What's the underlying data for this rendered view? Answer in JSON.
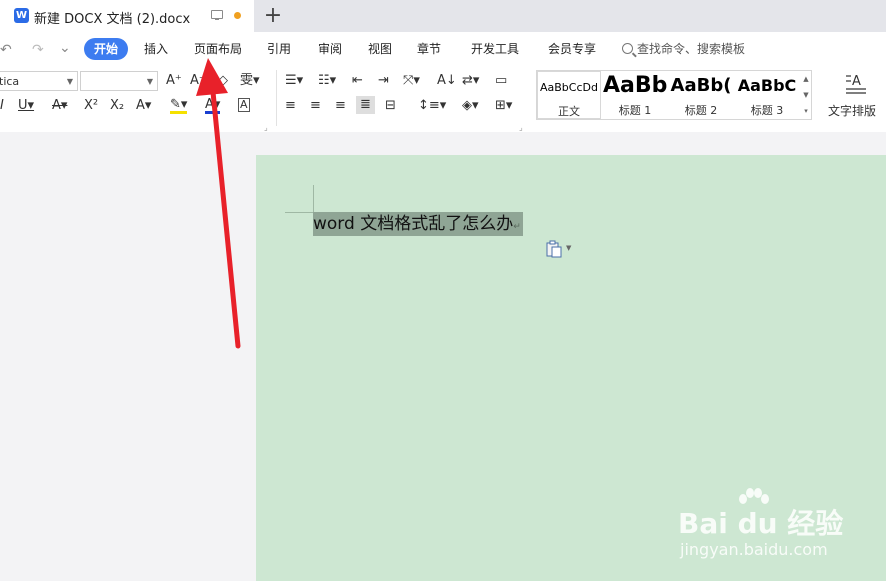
{
  "tab": {
    "logo_letter": "W",
    "title": "新建 DOCX 文档 (2).docx",
    "add_symbol": "+"
  },
  "quick_access": {
    "undo": "↶",
    "redo": "↷",
    "more": "⌄"
  },
  "menu": {
    "items": [
      {
        "label": "开始"
      },
      {
        "label": "插入"
      },
      {
        "label": "页面布局"
      },
      {
        "label": "引用"
      },
      {
        "label": "审阅"
      },
      {
        "label": "视图"
      },
      {
        "label": "章节"
      },
      {
        "label": "开发工具"
      },
      {
        "label": "会员专享"
      }
    ],
    "search_placeholder": "查找命令、搜索模板"
  },
  "font": {
    "name": "tica",
    "size": ""
  },
  "styles": [
    {
      "sample": "AaBbCcDd",
      "name": "正文"
    },
    {
      "sample": "AaBb",
      "name": "标题 1"
    },
    {
      "sample": "AaBb(",
      "name": "标题 2"
    },
    {
      "sample": "AaBbC",
      "name": "标题 3"
    }
  ],
  "text_layout_label": "文字排版",
  "document": {
    "line_text": "word 文档格式乱了怎么办",
    "paragraph_mark": "↵"
  },
  "watermark": {
    "brand": "Bai  du 经验",
    "site": "jingyan.baidu.com"
  },
  "colors": {
    "accent": "#3d7cf0",
    "page_bg": "#cde7d2",
    "selection": "#8fa595",
    "arrow": "#e8212a"
  }
}
